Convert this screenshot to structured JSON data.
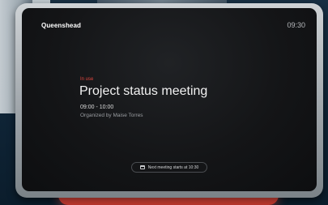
{
  "device": {
    "room_name": "Queenshead",
    "clock": "09:30"
  },
  "meeting": {
    "status": "In use",
    "title": "Project status meeting",
    "time_range": "09:00 - 10:00",
    "organizer": "Organized by Maise Torres"
  },
  "next_meeting": {
    "icon": "calendar-icon",
    "label": "Next meeting starts at 10:30"
  },
  "colors": {
    "status_accent": "#e2473f",
    "stand_light": "#ff6a5e"
  }
}
